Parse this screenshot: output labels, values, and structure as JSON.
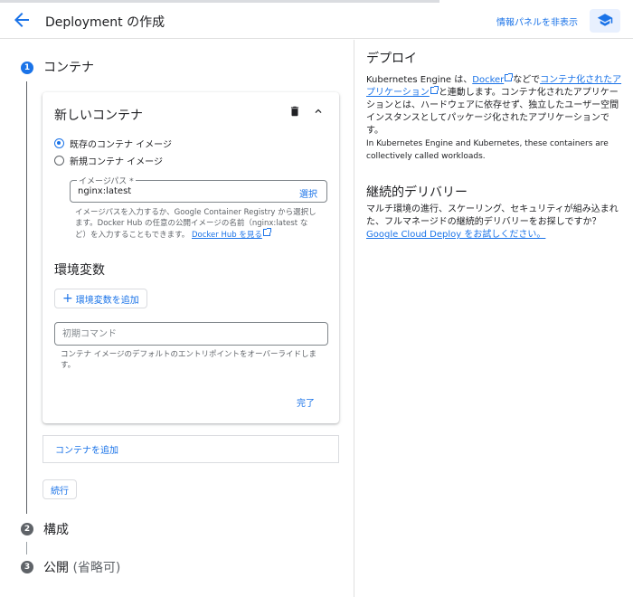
{
  "header": {
    "title": "Deployment の作成",
    "hide_panel": "情報パネルを非表示"
  },
  "steps": [
    {
      "num": "1",
      "label": "コンテナ"
    },
    {
      "num": "2",
      "label": "構成"
    },
    {
      "num": "3",
      "label": "公開",
      "suffix": " (省略可)"
    }
  ],
  "card": {
    "title": "新しいコンテナ",
    "radio_existing": "既存のコンテナ イメージ",
    "radio_new": "新規コンテナ イメージ",
    "image_label": "イメージパス *",
    "image_value": "nginx:latest",
    "image_select": "選択",
    "image_help_1": "イメージパスを入力するか、Google Container Registry から選択します。Docker Hub の任意の公開イメージの名前（nginx:latest など）を入力することもできます。",
    "image_help_link": "Docker Hub を見る",
    "env_title": "環境変数",
    "add_env": "環境変数を追加",
    "cmd_placeholder": "初期コマンド",
    "cmd_help": "コンテナ イメージのデフォルトのエントリポイントをオーバーライドします。",
    "done": "完了"
  },
  "add_container": "コンテナを追加",
  "continue": "続行",
  "panel": {
    "deploy_title": "デプロイ",
    "deploy_text_1": "Kubernetes Engine は、",
    "deploy_link_docker": "Docker",
    "deploy_text_2": "などで",
    "deploy_link_container": "コンテナ化されたアプリケーション",
    "deploy_text_3": "と連動します。コンテナ化されたアプリケーションとは、ハードウェアに依存せず、独立したユーザー空間インスタンスとしてパッケージ化されたアプリケーションです。",
    "workloads": "In Kubernetes Engine and Kubernetes, these containers are collectively called workloads.",
    "cd_title": "継続的デリバリー",
    "cd_text": "マルチ環境の進行、スケーリング、セキュリティが組み込まれた、フルマネージドの継続的デリバリーをお探しですか？",
    "cd_link": "Google Cloud Deploy をお試しください。"
  },
  "colors": {
    "accent": "#1a73e8",
    "step_active": "#1a73e8",
    "step_inactive": "#5f6368"
  }
}
